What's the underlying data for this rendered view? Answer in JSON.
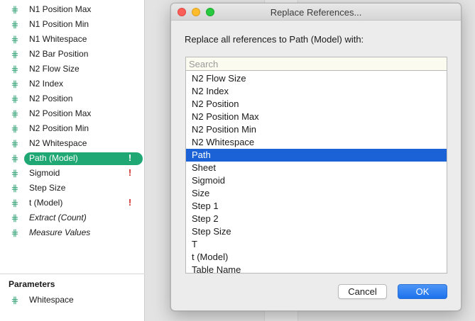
{
  "fields": [
    {
      "name": "N1 Position Max",
      "icon": "hash-icon",
      "warn": ""
    },
    {
      "name": "N1 Position Min",
      "icon": "hash-icon",
      "warn": ""
    },
    {
      "name": "N1 Whitespace",
      "icon": "hash-icon",
      "warn": ""
    },
    {
      "name": "N2 Bar Position",
      "icon": "hash-icon",
      "warn": ""
    },
    {
      "name": "N2 Flow Size",
      "icon": "hash-icon",
      "warn": ""
    },
    {
      "name": "N2 Index",
      "icon": "hash-icon",
      "warn": ""
    },
    {
      "name": "N2 Position",
      "icon": "hash-icon",
      "warn": ""
    },
    {
      "name": "N2 Position Max",
      "icon": "hash-icon",
      "warn": ""
    },
    {
      "name": "N2 Position Min",
      "icon": "hash-icon",
      "warn": ""
    },
    {
      "name": "N2 Whitespace",
      "icon": "hash-icon",
      "warn": ""
    },
    {
      "name": "Path (Model)",
      "icon": "hash-icon",
      "warn": "!"
    },
    {
      "name": "Sigmoid",
      "icon": "hash-icon",
      "warn": "!"
    },
    {
      "name": "Step Size",
      "icon": "hash-icon",
      "warn": ""
    },
    {
      "name": "t (Model)",
      "icon": "hash-icon",
      "warn": "!"
    },
    {
      "name": "Extract (Count)",
      "icon": "hash-icon",
      "warn": ""
    },
    {
      "name": "Measure Values",
      "icon": "hash-icon",
      "warn": ""
    }
  ],
  "parameters": {
    "title": "Parameters",
    "items": [
      {
        "name": "Whitespace",
        "icon": "hash-icon"
      }
    ]
  },
  "dialog": {
    "title": "Replace References...",
    "prompt": "Replace all references to Path (Model) with:",
    "search_placeholder": "Search",
    "options": [
      "N2 Flow Size",
      "N2 Index",
      "N2 Position",
      "N2 Position Max",
      "N2 Position Min",
      "N2 Whitespace",
      "Path",
      "Sheet",
      "Sigmoid",
      "Size",
      "Step 1",
      "Step 2",
      "Step Size",
      "T",
      "t (Model)",
      "Table Name"
    ],
    "selected_option": "Path",
    "cancel_label": "Cancel",
    "ok_label": "OK"
  },
  "colors": {
    "field_icon": "#3aa57a",
    "selected_pill": "#1fa774",
    "warning": "#d0312d",
    "list_selection": "#1a62d6",
    "ok_button": "#1c72ec"
  }
}
